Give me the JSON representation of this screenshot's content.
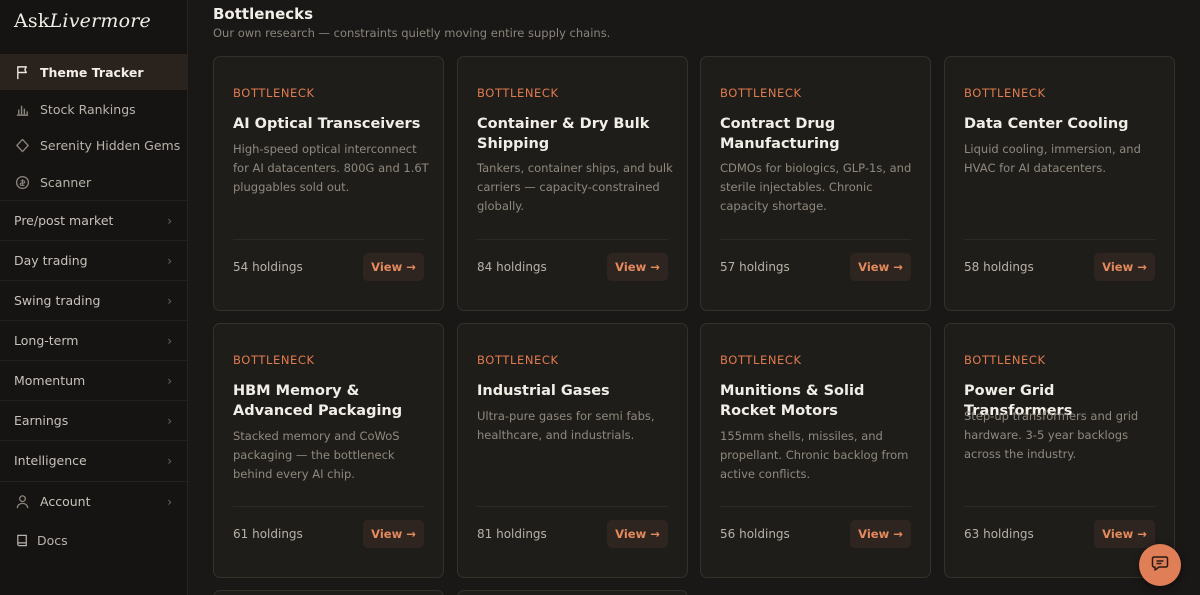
{
  "brand": {
    "prefix": "Ask",
    "suffix": "Livermore"
  },
  "sidebar": {
    "items": [
      {
        "label": "Theme Tracker",
        "icon": "flag-icon"
      },
      {
        "label": "Stock Rankings",
        "icon": "bar-chart-icon"
      },
      {
        "label": "Serenity Hidden Gems",
        "icon": "diamond-icon"
      },
      {
        "label": "Scanner",
        "icon": "scanner-icon"
      }
    ],
    "groups": [
      {
        "label": "Pre/post market"
      },
      {
        "label": "Day trading"
      },
      {
        "label": "Swing trading"
      },
      {
        "label": "Long-term"
      },
      {
        "label": "Momentum"
      },
      {
        "label": "Earnings"
      },
      {
        "label": "Intelligence"
      }
    ],
    "account": {
      "label": "Account",
      "icon": "user-icon"
    },
    "docs": {
      "label": "Docs",
      "icon": "book-icon"
    }
  },
  "header": {
    "title": "Bottlenecks",
    "subtitle": "Our own research — constraints quietly moving entire supply chains."
  },
  "cards": [
    {
      "tag": "BOTTLENECK",
      "title": "AI Optical Transceivers",
      "desc": "High-speed optical interconnect for AI datacenters. 800G and 1.6T pluggables sold out.",
      "count": "54 holdings",
      "button": "View →"
    },
    {
      "tag": "BOTTLENECK",
      "title": "Container & Dry Bulk Shipping",
      "desc": "Tankers, container ships, and bulk carriers — capacity-constrained globally.",
      "count": "84 holdings",
      "button": "View →"
    },
    {
      "tag": "BOTTLENECK",
      "title": "Contract Drug Manufacturing",
      "desc": "CDMOs for biologics, GLP-1s, and sterile injectables. Chronic capacity shortage.",
      "count": "57 holdings",
      "button": "View →"
    },
    {
      "tag": "BOTTLENECK",
      "title": "Data Center Cooling",
      "desc": "Liquid cooling, immersion, and HVAC for AI datacenters.",
      "count": "58 holdings",
      "button": "View →"
    },
    {
      "tag": "BOTTLENECK",
      "title": "HBM Memory & Advanced Packaging",
      "desc": "Stacked memory and CoWoS packaging — the bottleneck behind every AI chip.",
      "count": "61 holdings",
      "button": "View →"
    },
    {
      "tag": "BOTTLENECK",
      "title": "Industrial Gases",
      "desc": "Ultra-pure gases for semi fabs, healthcare, and industrials.",
      "count": "81 holdings",
      "button": "View →"
    },
    {
      "tag": "BOTTLENECK",
      "title": "Munitions & Solid Rocket Motors",
      "desc": "155mm shells, missiles, and propellant. Chronic backlog from active conflicts.",
      "count": "56 holdings",
      "button": "View →"
    },
    {
      "tag": "BOTTLENECK",
      "title": "Power Grid Transformers",
      "desc": "Step-up transformers and grid hardware. 3-5 year backlogs across the industry.",
      "count": "63 holdings",
      "button": "View →"
    }
  ],
  "colors": {
    "accent": "#e07b4e",
    "background": "#191816",
    "card": "#1f1d19"
  }
}
